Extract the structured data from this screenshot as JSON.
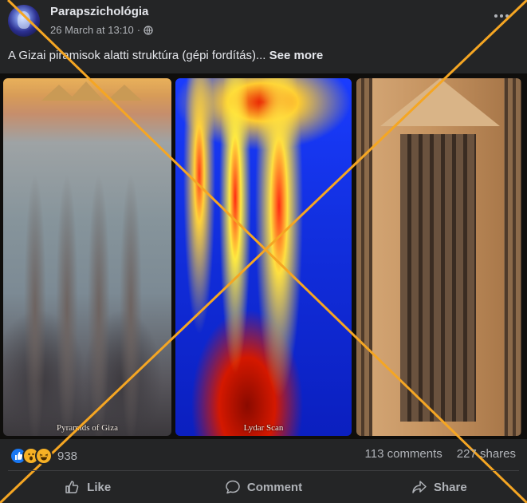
{
  "post": {
    "page_name": "Parapszichológia",
    "timestamp": "26 March at 13:10",
    "separator": "·",
    "caption": "A Gizai piramisok alatti struktúra (gépi fordítás)...",
    "see_more": "See more"
  },
  "media": {
    "panels": [
      {
        "label": "Pyramids of Giza"
      },
      {
        "label": "Lydar Scan"
      },
      {
        "label": ""
      }
    ]
  },
  "stats": {
    "reaction_count": "938",
    "comments": "113 comments",
    "shares": "227 shares"
  },
  "actions": {
    "like": "Like",
    "comment": "Comment",
    "share": "Share"
  },
  "colors": {
    "background": "#242526",
    "text": "#e4e6eb",
    "muted": "#b0b3b8",
    "overlay_x": "#f5a623"
  }
}
